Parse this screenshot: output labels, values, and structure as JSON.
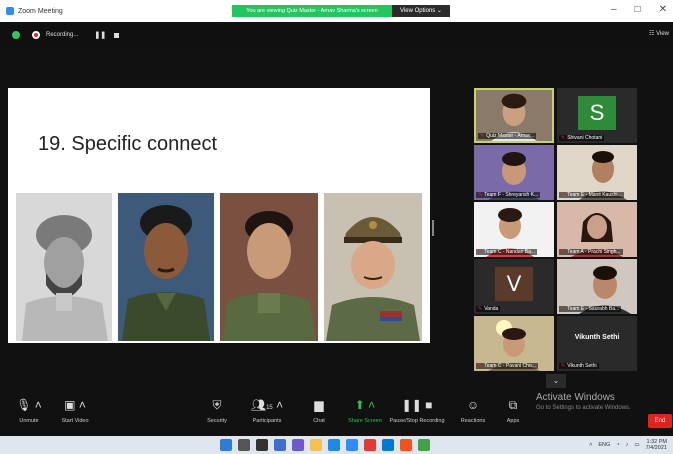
{
  "window": {
    "title": "Zoom Meeting",
    "share_banner": "You are viewing Quiz Master - Arnav Sharma's screen",
    "view_options": "View Options",
    "controls": [
      "–",
      "□",
      "✕"
    ]
  },
  "recording": {
    "label": "Recording...",
    "pause_icon": "pause-icon",
    "stop_icon": "stop-icon",
    "view_label": "View"
  },
  "slide": {
    "title": "19. Specific connect",
    "portraits": [
      "turbaned-man-sketch",
      "soldier-portrait-1",
      "soldier-portrait-2",
      "soldier-portrait-officer-cap"
    ]
  },
  "gallery": [
    {
      "name": "Quiz Master - Arnav...",
      "type": "video",
      "active": true
    },
    {
      "name": "Shivani Chotani",
      "type": "avatar",
      "letter": "S",
      "color": "#2e8b3a"
    },
    {
      "name": "Team F - Shreyansh K...",
      "type": "video"
    },
    {
      "name": "Team E - Manit Kaushi...",
      "type": "video"
    },
    {
      "name": "Team C - Nandan Ba...",
      "type": "video"
    },
    {
      "name": "Team A - Prachi Singh...",
      "type": "video"
    },
    {
      "name": "Vanda",
      "type": "avatar",
      "letter": "V",
      "color": "#5a3a2a"
    },
    {
      "name": "Team E - Saurabh Ba...",
      "type": "video"
    },
    {
      "name": "Team C - Pavani Cho...",
      "type": "video"
    },
    {
      "name": "Vikunth Sethi",
      "type": "name",
      "big_name": "Vikunth Sethi"
    }
  ],
  "watermark": {
    "title": "Activate Windows",
    "subtitle": "Go to Settings to activate Windows."
  },
  "toolbar": {
    "unmute": "Unmute",
    "start_video": "Start Video",
    "security": "Security",
    "participants": "Participants",
    "participants_count": "15",
    "chat": "Chat",
    "share_screen": "Share Screen",
    "pause_recording": "Pause/Stop Recording",
    "reactions": "Reactions",
    "apps": "Apps",
    "end": "End"
  },
  "taskbar": {
    "language": "ENG",
    "time": "1:32 PM",
    "date": "7/4/2021"
  },
  "colors": {
    "accent_green": "#29c25d",
    "end_red": "#e0241c",
    "active_border": "#c6d26d",
    "share_banner": "#23c55e"
  }
}
